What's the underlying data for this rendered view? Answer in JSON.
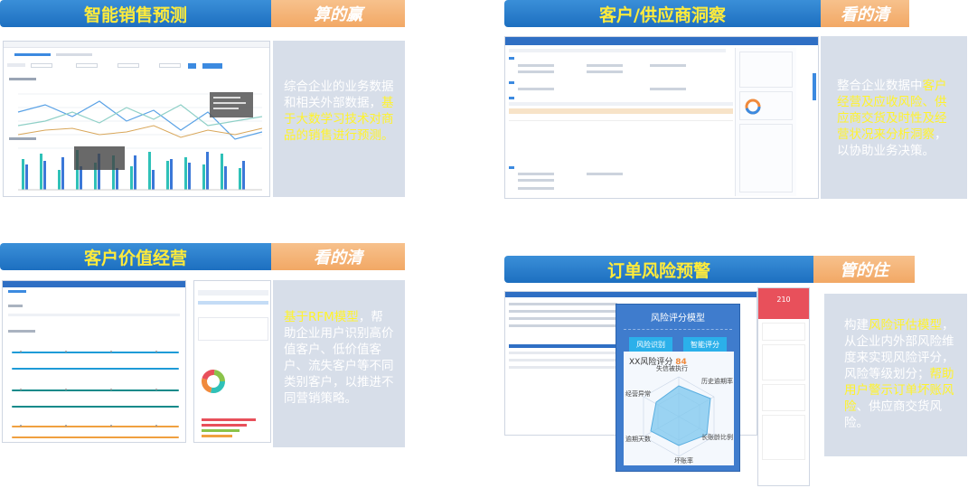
{
  "panels": {
    "p1": {
      "title": "智能销售预测",
      "tag": "算的赢",
      "desc": [
        {
          "text": "综合企业的业务数据和相关外部数据，",
          "hl": false
        },
        {
          "text": "基于大数学习技术对商品的销售进行预测。",
          "hl": true
        }
      ]
    },
    "p2": {
      "title": "客户/供应商洞察",
      "tag": "看的清",
      "desc": [
        {
          "text": "整合企业数据中",
          "hl": false
        },
        {
          "text": "客户经营及应收风险、供应商交货及时性及经营状况来分析洞察",
          "hl": true
        },
        {
          "text": "，以协助业务决策。",
          "hl": false
        }
      ]
    },
    "p3": {
      "title": "客户价值经营",
      "tag": "看的清",
      "desc": [
        {
          "text": "基于RFM模型",
          "hl": true
        },
        {
          "text": "，帮助企业用户识别高价值客户、低价值客户、流失客户等不同类别客户，以推进不同营销策略。",
          "hl": false
        }
      ]
    },
    "p4": {
      "title": "订单风险预警",
      "tag": "管的住",
      "desc": [
        {
          "text": "构建",
          "hl": false
        },
        {
          "text": "风险评估模型",
          "hl": true
        },
        {
          "text": "，从企业内外部风险维度来实现风险评分，风险等级划分；",
          "hl": false
        },
        {
          "text": "帮助用户警示订单坏账风险",
          "hl": true
        },
        {
          "text": "、供应商交货风险。",
          "hl": false
        }
      ],
      "risk_model": {
        "title": "风险评分模型",
        "btn1": "风险识别",
        "btn2": "智能评分",
        "score_label": "XX风险评分",
        "score": "84",
        "axes": [
          "失信被执行",
          "历史逾期率",
          "长账龄比例",
          "坏账率",
          "逾期天数",
          "经营异常"
        ]
      },
      "side_score": "210"
    }
  },
  "colors": {
    "banner_blue": "#1d6fc0",
    "banner_text": "#ffeb3b",
    "tag_orange": "#f2a865",
    "desc_bg": "#d7dee9",
    "highlight": "#fff32d"
  }
}
